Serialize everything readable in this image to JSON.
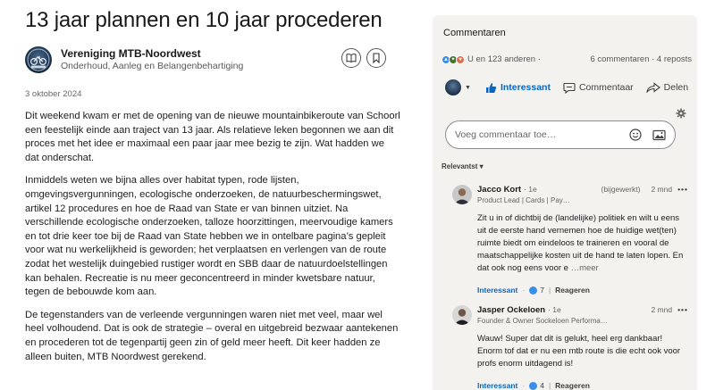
{
  "article": {
    "title": "13 jaar plannen en 10 jaar procederen",
    "author": {
      "name": "Vereniging MTB-Noordwest",
      "subtitle": "Onderhoud, Aanleg en Belangenbehartiging",
      "logo_text": "MTB-NOORDWEST"
    },
    "date": "3 oktober 2024",
    "paragraphs": [
      "Dit weekend kwam er met de opening van de nieuwe mountainbikeroute van Schoorl een feestelijk einde aan traject van 13 jaar. Als relatieve leken begonnen we aan dit proces met het idee er maximaal een paar jaar mee bezig te zijn. Wat hadden we dat onderschat.",
      "Inmiddels weten we bijna alles over habitat typen, rode lijsten, omgevingsvergunningen, ecologische onderzoeken, de natuurbeschermingswet, artikel 12 procedures en hoe de Raad van State er van binnen uitziet. Na verschillende ecologische onderzoeken, talloze hoorzittingen, meervoudige kamers en tot drie keer toe bij de Raad van State hebben we in ontelbare pagina’s gepleit voor wat nu werkelijkheid is geworden; het verplaatsen en verlengen van de route zodat het westelijk duingebied rustiger wordt en SBB daar de natuurdoelstellingen kan behalen.  Recreatie is nu meer geconcentreerd in minder kwetsbare natuur, tegen de bebouwde kom aan.",
      "De tegenstanders van de verleende vergunningen waren niet met veel, maar wel heel volhoudend.  Dat is ook de strategie – overal  en uitgebreid bezwaar aantekenen en procederen tot de tegenpartij geen zin of geld meer heeft. Dit keer hadden ze alleen buiten, MTB Noordwest gerekend."
    ]
  },
  "panel": {
    "title": "Commentaren",
    "reactions_text": "U en 123 anderen ·",
    "stats_text": "6 commentaren · 4 reposts",
    "actions": {
      "like": "Interessant",
      "comment": "Commentaar",
      "share": "Delen"
    },
    "comment_placeholder": "Voeg commentaar toe…",
    "sort_label": "Relevantst ▾",
    "comments": [
      {
        "name": "Jacco Kort",
        "degree": "· 1e",
        "edited": "(bijgewerkt)",
        "time": "2 mnd",
        "dots": "•••",
        "headline": "Product Lead | Cards | Pay…",
        "text": "Zit u in of dichtbij de (landelijke) politiek en wilt u eens uit de eerste hand vernemen hoe de huidige wet(ten) ruimte biedt om eindeloos te traineren en vooral de maatschappelijke kosten uit de hand te laten lopen. En dat ook nog eens voor e",
        "more": "…meer",
        "like_label": "Interessant",
        "likes": "7",
        "reply_label": "Reageren"
      },
      {
        "name": "Jasper Ockeloen",
        "degree": "· 1e",
        "edited": "",
        "time": "2 mnd",
        "dots": "•••",
        "headline": "Founder & Owner Sockeloen Performa…",
        "text": "Wauw! Super dat dit is gelukt, heel erg dankbaar! Enorm tof dat er nu een mtb route is die echt ook voor profs enorm uitdagend is!",
        "more": "",
        "like_label": "Interessant",
        "likes": "4",
        "reply_label": "Reageren"
      }
    ]
  },
  "colors": {
    "accent": "#0a66c2",
    "panel_bg": "#f3f2ef",
    "text": "#1d1d1d",
    "muted": "#666666"
  },
  "icons": [
    "bookmark-book-icon",
    "bookmark-icon",
    "like-thumb-icon",
    "comment-bubble-icon",
    "share-arrow-icon",
    "gear-icon",
    "emoji-icon",
    "image-icon",
    "caret-down-icon"
  ]
}
